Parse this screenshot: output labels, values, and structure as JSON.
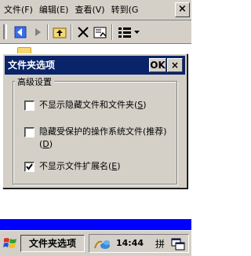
{
  "menubar": {
    "items": [
      "文件(F)",
      "编辑(E)",
      "查看(V)",
      "转到(G"
    ],
    "close_label": "×"
  },
  "toolbar": {
    "icons": [
      "back-icon",
      "forward-icon",
      "up-folder-icon",
      "delete-icon",
      "properties-icon",
      "view-menu-icon"
    ]
  },
  "dialog": {
    "title": "文件夹选项",
    "ok_label": "OK",
    "close_label": "×",
    "group_label": "高级设置",
    "options": [
      {
        "text": "不显示隐藏文件和文件夹(",
        "key": "S",
        "suffix": ")",
        "checked": false
      },
      {
        "text": "隐藏受保护的操作系统文件(推荐)(",
        "key": "D",
        "suffix": ")",
        "checked": false
      },
      {
        "text": "不显示文件扩展名(",
        "key": "E",
        "suffix": ")",
        "checked": true
      }
    ]
  },
  "taskbar": {
    "task_label": "文件夹选项",
    "clock": "14:44",
    "ime_label": "拼"
  },
  "colors": {
    "titlebar": "#0a246a",
    "chrome": "#d4d0c8",
    "accent_strip": "#0000ff"
  }
}
